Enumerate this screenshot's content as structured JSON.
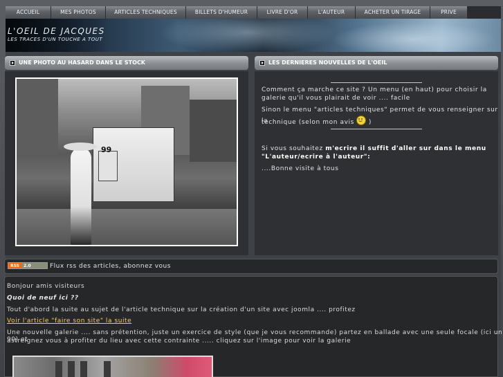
{
  "nav": {
    "items": [
      {
        "label": "ACCUEIL"
      },
      {
        "label": "MES PHOTOS"
      },
      {
        "label": "ARTICLES TECHNIQUES"
      },
      {
        "label": "BILLETS D'HUMEUR"
      },
      {
        "label": "LIVRE D'OR"
      },
      {
        "label": "L'AUTEUR"
      },
      {
        "label": "ACHETER UN TIRAGE"
      },
      {
        "label": "PRIVE"
      }
    ]
  },
  "header": {
    "title": "L'OEIL DE JACQUES",
    "tagline": "LES TRACES D'UN TOUCHE A TOUT"
  },
  "left_panel": {
    "heading": "UNE PHOTO AU HASARD DANS LE STOCK",
    "photo_number": "99"
  },
  "right_panel": {
    "heading": "LES DERNIERES NOUVELLES DE L'OEIL",
    "line1": "Comment ça marche ce site  ?   Un menu (en haut) pour choisir la",
    "line2": "galerie qu'il vous plairait de voir .... facile",
    "line3": "Sinon le menu \"articles techniques\" permet de vous renseigner sur la",
    "line4": "technique (selon mon avis",
    "line4_end": ")",
    "line5_start": "Si vous souhaitez ",
    "line5_bold": "m'ecrire il suffit d'aller sur dans le menu",
    "line6_bold": "\"L'auteur/ecrire à l'auteur\":",
    "line7": "....Bonne visite à tous"
  },
  "rss": {
    "badge_left": "RSS",
    "badge_right": "2.0",
    "text": "Flux rss des articles, abonnez vous"
  },
  "main": {
    "greeting": "Bonjour amis visiteurs",
    "subheading": "Quoi de neuf ici ??",
    "p1": "Tout d'abord la suite au sujet de l'article technique sur la création d'un site avec joomla .... profitez",
    "link": "Voir l'article \"faire son site\" la suite",
    "p2a": "Une nouvelle galerie .... sans prétention, juste un exercice de style (que je vous recommande) partez en ballade avec une seule focale (ici un 90) et",
    "p2b": "astreignez vous à profiter du lieu avec cette contrainte ..... cliquez sur l'image pour voir la galerie"
  },
  "colors": {
    "accent_link": "#ffd23a",
    "rss_orange": "#ff6600"
  }
}
